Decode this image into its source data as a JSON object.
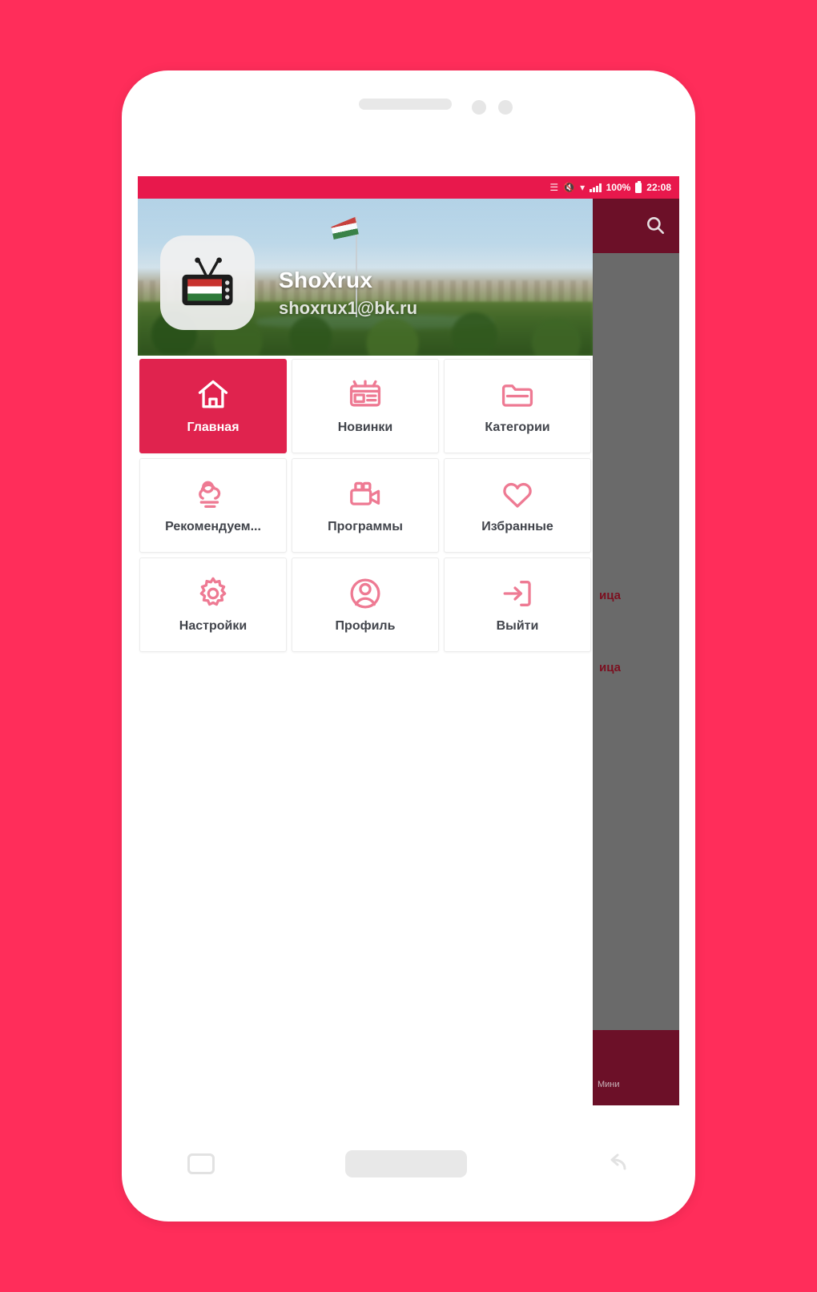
{
  "app": {
    "background_color": "#FF2D5A",
    "accent_color": "#E0234E",
    "toolbar_color": "#6C1028",
    "status_bar_color": "#E8184C"
  },
  "status_bar": {
    "battery_percent": "100%",
    "time": "22:08",
    "icons": [
      "vibrate-icon",
      "mute-icon",
      "wifi-icon",
      "signal-icon",
      "battery-icon"
    ]
  },
  "drawer": {
    "header": {
      "title": "ShoXrux",
      "subtitle": "shoxrux1@bk.ru",
      "avatar_icon": "tv-icon"
    },
    "menu": [
      {
        "label": "Главная",
        "icon": "home-icon",
        "active": true
      },
      {
        "label": "Новинки",
        "icon": "new-releases-icon",
        "active": false
      },
      {
        "label": "Категории",
        "icon": "folder-icon",
        "active": false
      },
      {
        "label": "Рекомендуем...",
        "icon": "cloud-sun-icon",
        "active": false
      },
      {
        "label": "Программы",
        "icon": "video-icon",
        "active": false
      },
      {
        "label": "Избранные",
        "icon": "heart-icon",
        "active": false
      },
      {
        "label": "Настройки",
        "icon": "gear-icon",
        "active": false
      },
      {
        "label": "Профиль",
        "icon": "person-icon",
        "active": false
      },
      {
        "label": "Выйти",
        "icon": "logout-icon",
        "active": false
      }
    ]
  },
  "activity": {
    "search_icon": "search-icon",
    "row_texts": [
      "ица",
      "ица"
    ],
    "bottom_text": "Мини"
  },
  "phone": {
    "nav": {
      "recent_label": "recent-apps-button",
      "home_label": "home-button",
      "back_label": "back-button"
    }
  }
}
